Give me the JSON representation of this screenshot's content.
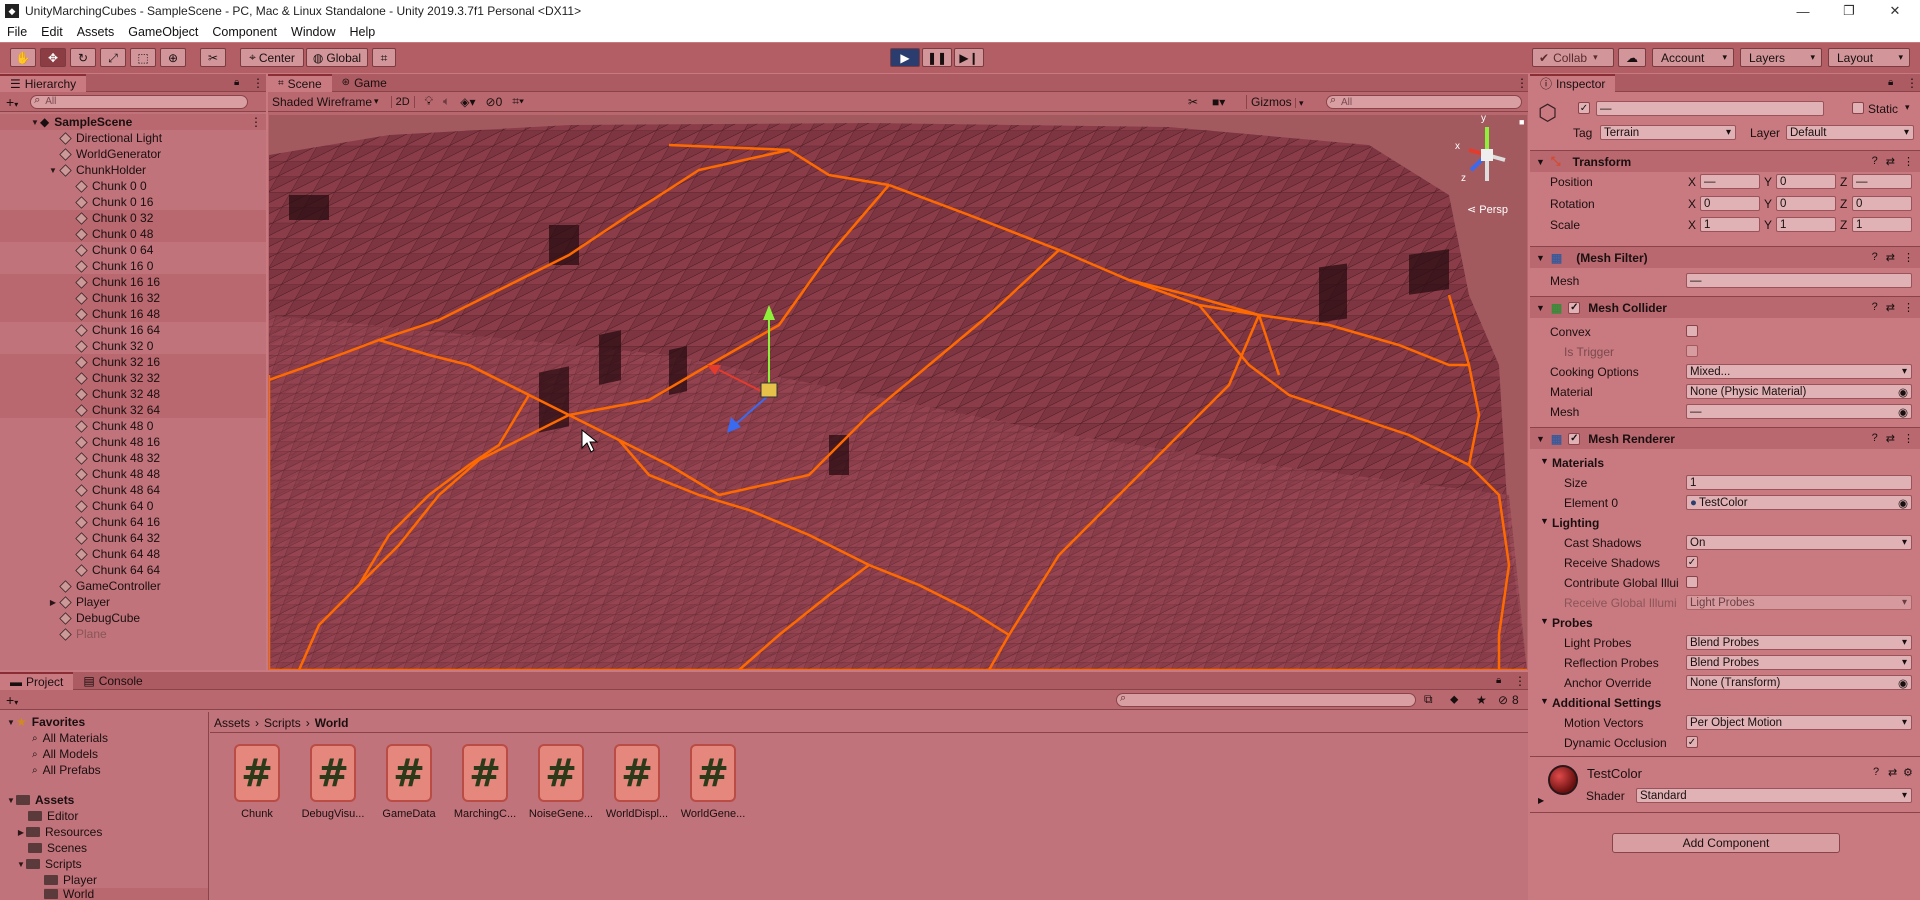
{
  "window": {
    "title": "UnityMarchingCubes - SampleScene - PC, Mac & Linux Standalone - Unity 2019.3.7f1 Personal <DX11>"
  },
  "menu": [
    "File",
    "Edit",
    "Assets",
    "GameObject",
    "Component",
    "Window",
    "Help"
  ],
  "toolbar": {
    "pivot": "Center",
    "space": "Global",
    "collab": "Collab",
    "account": "Account",
    "layers": "Layers",
    "layout": "Layout"
  },
  "hierarchy": {
    "tab": "Hierarchy",
    "search_placeholder": "All",
    "scene": "SampleScene",
    "items": [
      {
        "label": "Directional Light"
      },
      {
        "label": "WorldGenerator"
      },
      {
        "label": "ChunkHolder"
      },
      {
        "label": "Chunk 0 0"
      },
      {
        "label": "Chunk 0 16"
      },
      {
        "label": "Chunk 0 32"
      },
      {
        "label": "Chunk 0 48"
      },
      {
        "label": "Chunk 0 64"
      },
      {
        "label": "Chunk 16 0"
      },
      {
        "label": "Chunk 16 16"
      },
      {
        "label": "Chunk 16 32"
      },
      {
        "label": "Chunk 16 48"
      },
      {
        "label": "Chunk 16 64"
      },
      {
        "label": "Chunk 32 0"
      },
      {
        "label": "Chunk 32 16"
      },
      {
        "label": "Chunk 32 32"
      },
      {
        "label": "Chunk 32 48"
      },
      {
        "label": "Chunk 32 64"
      },
      {
        "label": "Chunk 48 0"
      },
      {
        "label": "Chunk 48 16"
      },
      {
        "label": "Chunk 48 32"
      },
      {
        "label": "Chunk 48 48"
      },
      {
        "label": "Chunk 48 64"
      },
      {
        "label": "Chunk 64 0"
      },
      {
        "label": "Chunk 64 16"
      },
      {
        "label": "Chunk 64 32"
      },
      {
        "label": "Chunk 64 48"
      },
      {
        "label": "Chunk 64 64"
      },
      {
        "label": "GameController"
      },
      {
        "label": "Player"
      },
      {
        "label": "DebugCube"
      },
      {
        "label": "Plane"
      }
    ]
  },
  "scene_view": {
    "tabs": [
      "Scene",
      "Game"
    ],
    "shading": "Shaded Wireframe",
    "mode_2d": "2D",
    "hidden_count": "0",
    "gizmos": "Gizmos",
    "search_placeholder": "All",
    "persp": "Persp",
    "axis_x": "x",
    "axis_y": "y",
    "axis_z": "z"
  },
  "inspector": {
    "tab": "Inspector",
    "name": "—",
    "static_label": "Static",
    "tag_label": "Tag",
    "tag_value": "Terrain",
    "layer_label": "Layer",
    "layer_value": "Default",
    "transform": {
      "title": "Transform",
      "position_label": "Position",
      "position": [
        "—",
        "0",
        "—"
      ],
      "rotation_label": "Rotation",
      "rotation": [
        "0",
        "0",
        "0"
      ],
      "scale_label": "Scale",
      "scale": [
        "1",
        "1",
        "1"
      ]
    },
    "mesh_filter": {
      "title": "(Mesh Filter)",
      "mesh_label": "Mesh",
      "mesh": "—"
    },
    "mesh_collider": {
      "title": "Mesh Collider",
      "convex_label": "Convex",
      "is_trigger_label": "Is Trigger",
      "cooking_label": "Cooking Options",
      "cooking": "Mixed...",
      "material_label": "Material",
      "material": "None (Physic Material)",
      "mesh_label": "Mesh",
      "mesh": "—"
    },
    "mesh_renderer": {
      "title": "Mesh Renderer",
      "materials_label": "Materials",
      "size_label": "Size",
      "size": "1",
      "element0_label": "Element 0",
      "element0": "TestColor",
      "lighting_label": "Lighting",
      "cast_shadows_label": "Cast Shadows",
      "cast_shadows": "On",
      "receive_shadows_label": "Receive Shadows",
      "contribute_gi_label": "Contribute Global Illui",
      "receive_gi_label": "Receive Global Illumi",
      "receive_gi": "Light Probes",
      "probes_label": "Probes",
      "light_probes_label": "Light Probes",
      "light_probes": "Blend Probes",
      "reflection_probes_label": "Reflection Probes",
      "reflection_probes": "Blend Probes",
      "anchor_label": "Anchor Override",
      "anchor": "None (Transform)",
      "additional_label": "Additional Settings",
      "motion_vectors_label": "Motion Vectors",
      "motion_vectors": "Per Object Motion",
      "dynamic_occlusion_label": "Dynamic Occlusion"
    },
    "material": {
      "name": "TestColor",
      "shader_label": "Shader",
      "shader": "Standard"
    },
    "add_component": "Add Component"
  },
  "project": {
    "tabs": [
      "Project",
      "Console"
    ],
    "hidden_count": "8",
    "favorites": {
      "label": "Favorites",
      "items": [
        "All Materials",
        "All Models",
        "All Prefabs"
      ]
    },
    "assets": {
      "label": "Assets",
      "items": [
        "Editor",
        "Resources",
        "Scenes",
        "Scripts",
        "Player",
        "World"
      ]
    },
    "breadcrumb": [
      "Assets",
      "Scripts",
      "World"
    ],
    "files": [
      "Chunk",
      "DebugVisu...",
      "GameData",
      "MarchingC...",
      "NoiseGene...",
      "WorldDispl...",
      "WorldGene..."
    ]
  },
  "colors": {
    "accent_orange": "#ff6a00",
    "terrain": "#8a3d49",
    "panel": "#c0737a"
  }
}
